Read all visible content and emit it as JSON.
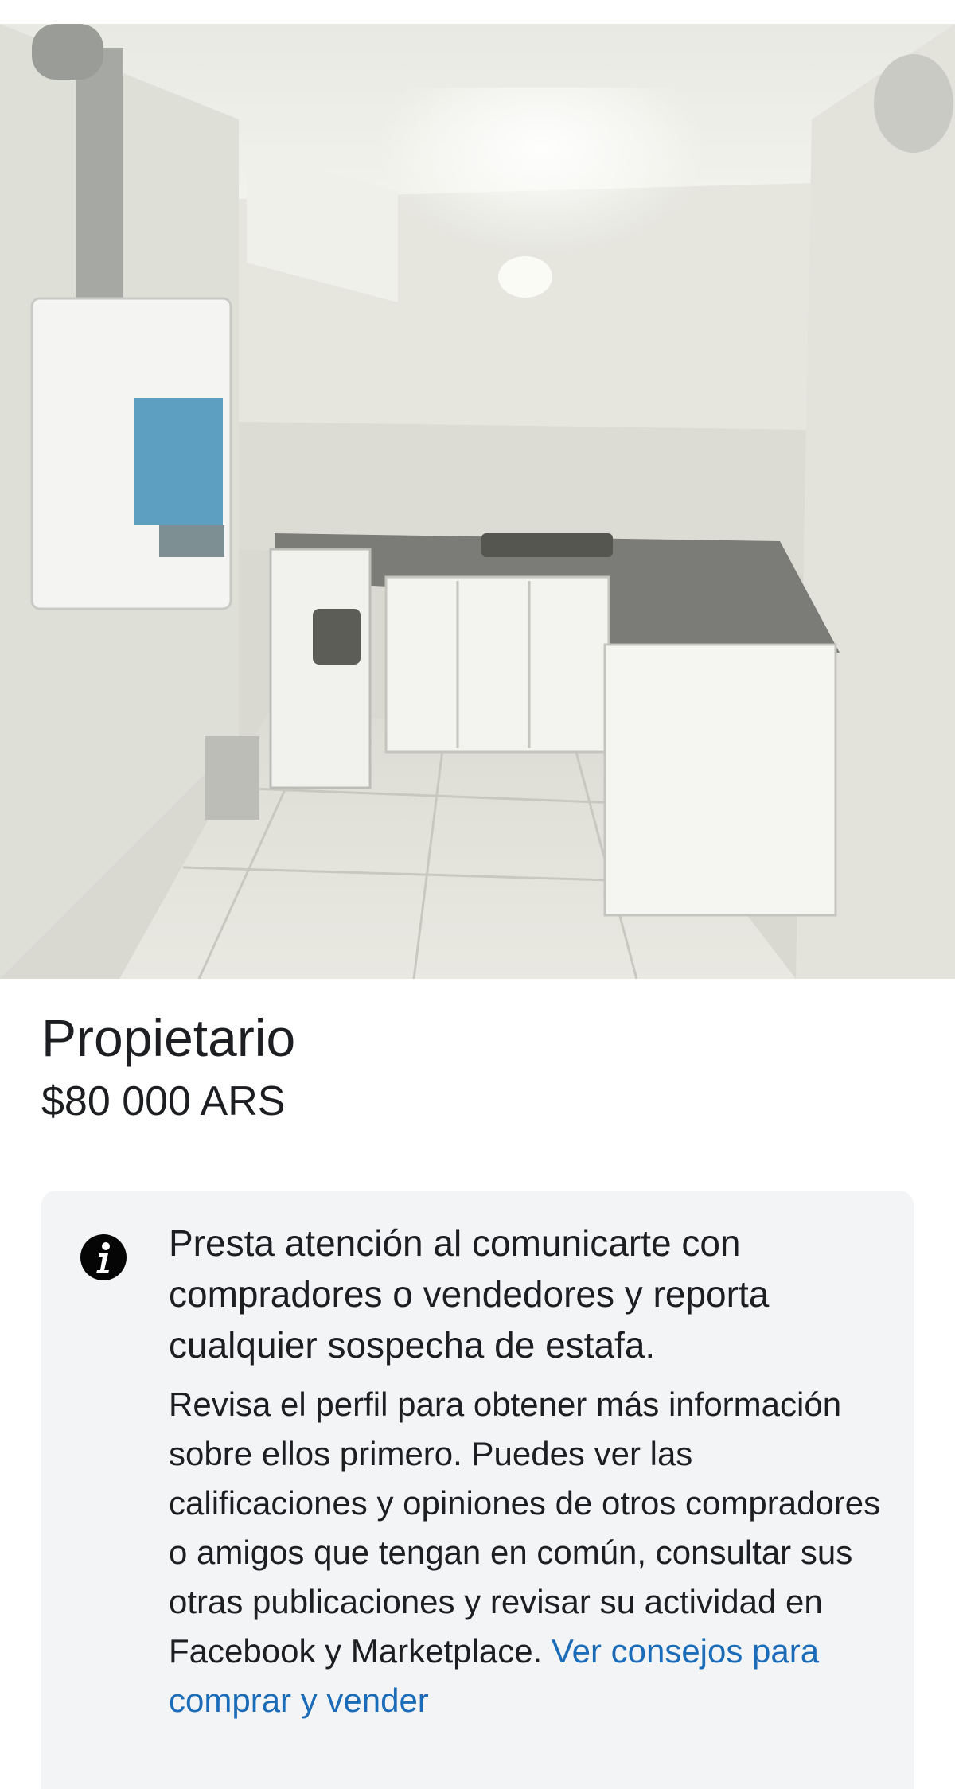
{
  "listing": {
    "photo_alt": "kitchen-photo",
    "title": "Propietario",
    "price": "$80 000 ARS"
  },
  "safety_notice": {
    "icon": "info-icon",
    "heading": "Presta atención al comunicarte con compradores o vendedores y reporta cualquier sospecha de estafa.",
    "body": "Revisa el perfil para obtener más información sobre ellos primero. Puedes ver las calificaciones y opiniones de otros compradores o amigos que tengan en común, consultar sus otras publicaciones y revisar su actividad en Facebook y Marketplace.",
    "link_label": "Ver consejos para comprar y vender"
  },
  "colors": {
    "link": "#1a6bb8",
    "card_background": "#f3f4f6",
    "text": "#1c1e21"
  }
}
